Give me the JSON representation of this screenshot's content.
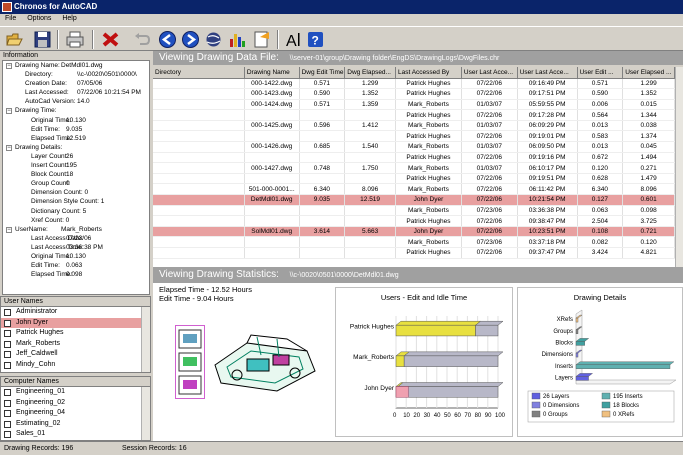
{
  "window": {
    "title": "Chronos for AutoCAD"
  },
  "menu": [
    "File",
    "Options",
    "Help"
  ],
  "info": {
    "header": "Information",
    "tree": [
      {
        "indent": 0,
        "toggle": "-",
        "key": "Drawing Name:",
        "val": "DetMdl01.dwg"
      },
      {
        "indent": 1,
        "key": "Directory:",
        "val": "\\\\c-\\0020\\0501\\0000\\"
      },
      {
        "indent": 1,
        "key": "Creation Date:",
        "val": "07/05/06"
      },
      {
        "indent": 1,
        "key": "Last Accessed:",
        "val": "07/22/06 10:21:54 PM"
      },
      {
        "indent": 1,
        "key": "AutoCad Version:",
        "val": "14.0"
      },
      {
        "indent": 0,
        "toggle": "-",
        "key": "Drawing Time:",
        "val": ""
      },
      {
        "indent": 2,
        "key": "Original Time:",
        "val": "10.130"
      },
      {
        "indent": 2,
        "key": "Edit Time:",
        "val": "9.035"
      },
      {
        "indent": 2,
        "key": "Elapsed Time:",
        "val": "12.519"
      },
      {
        "indent": 0,
        "toggle": "-",
        "key": "Drawing Details:",
        "val": ""
      },
      {
        "indent": 2,
        "key": "Layer Count:",
        "val": "26"
      },
      {
        "indent": 2,
        "key": "Insert Count:",
        "val": "195"
      },
      {
        "indent": 2,
        "key": "Block Count:",
        "val": "18"
      },
      {
        "indent": 2,
        "key": "Group Count:",
        "val": "0"
      },
      {
        "indent": 2,
        "key": "Dimension Count: 0",
        "val": ""
      },
      {
        "indent": 2,
        "key": "Dimension Style Count: 1",
        "val": ""
      },
      {
        "indent": 2,
        "key": "Dictionary Count: 5",
        "val": ""
      },
      {
        "indent": 2,
        "key": "Xref Count: 0",
        "val": ""
      },
      {
        "indent": 0,
        "toggle": "-",
        "key": "UserName:",
        "val": "Mark_Roberts"
      },
      {
        "indent": 2,
        "key": "Last Access Date:",
        "val": "07/23/06"
      },
      {
        "indent": 2,
        "key": "Last Access Time:",
        "val": "03:36:38 PM"
      },
      {
        "indent": 2,
        "key": "Original Time:",
        "val": "10.130"
      },
      {
        "indent": 2,
        "key": "Edit Time:",
        "val": "0.063"
      },
      {
        "indent": 2,
        "key": "Elapsed Time:",
        "val": "0.098"
      }
    ]
  },
  "users": {
    "header": "User Names",
    "items": [
      {
        "label": "Administrator",
        "selected": false
      },
      {
        "label": "John Dyer",
        "selected": true
      },
      {
        "label": "Patrick Hughes",
        "selected": false
      },
      {
        "label": "Mark_Roberts",
        "selected": false
      },
      {
        "label": "Jeff_Caldwell",
        "selected": false
      },
      {
        "label": "Mindy_Cohn",
        "selected": false
      }
    ]
  },
  "computers": {
    "header": "Computer Names",
    "items": [
      "Engineering_01",
      "Engineering_02",
      "Engineering_04",
      "Estimating_02",
      "Sales_01"
    ]
  },
  "datafile": {
    "title": "Viewing Drawing Data File:",
    "path": "\\\\server-01\\group\\Drawing folder\\EngDS\\DrawingLogs\\DwgFiles.chr",
    "columns": [
      "Directory",
      "Drawing Name",
      "Dwg Edit Time",
      "Dwg Elapsed...",
      "Last Accessed By",
      "User Last Acce...",
      "User Last Acce...",
      "User Edit ...",
      "User Elapsed ..."
    ],
    "rows": [
      {
        "hl": false,
        "c": [
          "",
          "000-1422.dwg",
          "0.571",
          "1.299",
          "Patrick Hughes",
          "07/22/06",
          "09:16:49 PM",
          "0.571",
          "1.299"
        ]
      },
      {
        "hl": false,
        "c": [
          "",
          "000-1423.dwg",
          "0.590",
          "1.352",
          "Patrick Hughes",
          "07/22/06",
          "09:17:51 PM",
          "0.590",
          "1.352"
        ]
      },
      {
        "hl": false,
        "c": [
          "",
          "000-1424.dwg",
          "0.571",
          "1.359",
          "Mark_Roberts",
          "01/03/07",
          "05:59:55 PM",
          "0.006",
          "0.015"
        ]
      },
      {
        "hl": false,
        "c": [
          "",
          "",
          "",
          "",
          "Patrick Hughes",
          "07/22/06",
          "09:17:28 PM",
          "0.564",
          "1.344"
        ]
      },
      {
        "hl": false,
        "c": [
          "",
          "000-1425.dwg",
          "0.596",
          "1.412",
          "Mark_Roberts",
          "01/03/07",
          "06:09:29 PM",
          "0.013",
          "0.038"
        ]
      },
      {
        "hl": false,
        "c": [
          "",
          "",
          "",
          "",
          "Patrick Hughes",
          "07/22/06",
          "09:19:01 PM",
          "0.583",
          "1.374"
        ]
      },
      {
        "hl": false,
        "c": [
          "",
          "000-1426.dwg",
          "0.685",
          "1.540",
          "Mark_Roberts",
          "01/03/07",
          "06:09:50 PM",
          "0.013",
          "0.045"
        ]
      },
      {
        "hl": false,
        "c": [
          "",
          "",
          "",
          "",
          "Patrick Hughes",
          "07/22/06",
          "09:19:16 PM",
          "0.672",
          "1.494"
        ]
      },
      {
        "hl": false,
        "c": [
          "",
          "000-1427.dwg",
          "0.748",
          "1.750",
          "Mark_Roberts",
          "01/03/07",
          "06:10:17 PM",
          "0.120",
          "0.271"
        ]
      },
      {
        "hl": false,
        "c": [
          "",
          "",
          "",
          "",
          "Patrick Hughes",
          "07/22/06",
          "09:19:51 PM",
          "0.628",
          "1.479"
        ]
      },
      {
        "hl": false,
        "c": [
          "",
          "501-000-0001...",
          "6.340",
          "8.096",
          "Mark_Roberts",
          "07/22/06",
          "06:11:42 PM",
          "6.340",
          "8.096"
        ]
      },
      {
        "hl": true,
        "c": [
          "",
          "DetMdl01.dwg",
          "9.035",
          "12.519",
          "John Dyer",
          "07/22/06",
          "10:21:54 PM",
          "0.127",
          "0.601"
        ]
      },
      {
        "hl": false,
        "c": [
          "",
          "",
          "",
          "",
          "Mark_Roberts",
          "07/23/06",
          "03:36:38 PM",
          "0.063",
          "0.098"
        ]
      },
      {
        "hl": false,
        "c": [
          "",
          "",
          "",
          "",
          "Patrick Hughes",
          "07/22/06",
          "09:38:47 PM",
          "2.504",
          "3.725"
        ]
      },
      {
        "hl": true,
        "c": [
          "",
          "SolMdl01.dwg",
          "3.614",
          "5.663",
          "John Dyer",
          "07/22/06",
          "10:23:51 PM",
          "0.108",
          "0.721"
        ]
      },
      {
        "hl": false,
        "c": [
          "",
          "",
          "",
          "",
          "Mark_Roberts",
          "07/23/06",
          "03:37:18 PM",
          "0.082",
          "0.120"
        ]
      },
      {
        "hl": false,
        "c": [
          "",
          "",
          "",
          "",
          "Patrick Hughes",
          "07/22/06",
          "09:37:47 PM",
          "3.424",
          "4.821"
        ]
      }
    ]
  },
  "stats": {
    "title": "Viewing Drawing Statistics:",
    "path": "\\\\c-\\0020\\0501\\0000\\DetMdl01.dwg",
    "elapsed": "Elapsed Time - 12.52 Hours",
    "edit": "Edit Time - 9.04 Hours"
  },
  "chart_data": [
    {
      "type": "bar",
      "title": "Users - Edit and Idle Time",
      "categories": [
        "Patrick Hughes",
        "Mark_Roberts",
        "John Dyer"
      ],
      "series": [
        {
          "values": [
            78,
            8,
            2
          ],
          "color": "#e8e040"
        },
        {
          "values": [
            22,
            92,
            98
          ],
          "color": "#b8b8c8"
        }
      ],
      "highlight": {
        "category": "John Dyer",
        "value": 12,
        "color": "#f0a0b0"
      },
      "xlim": [
        0,
        100
      ],
      "xticks": [
        "0",
        "10",
        "20",
        "30",
        "40",
        "50",
        "60",
        "70",
        "80",
        "90",
        "100"
      ]
    },
    {
      "type": "bar",
      "title": "Drawing Details",
      "categories": [
        "XRefs",
        "Groups",
        "Blocks",
        "Dimensions",
        "Inserts",
        "Layers"
      ],
      "values": [
        0,
        0,
        18,
        0,
        195,
        26
      ],
      "colors": [
        "#f0c080",
        "#808080",
        "#40a0a0",
        "#8080e0",
        "#60b0b0",
        "#6060e0"
      ],
      "legend": [
        "26 Layers",
        "195 Inserts",
        "0 Dimensions",
        "18 Blocks",
        "0 Groups",
        "0 XRefs"
      ],
      "legend_colors": [
        "#6060e0",
        "#60b0b0",
        "#8080e0",
        "#40a0a0",
        "#808080",
        "#f0c080"
      ]
    }
  ],
  "status": {
    "records": "Drawing Records: 196",
    "session": "Session Records: 16"
  }
}
